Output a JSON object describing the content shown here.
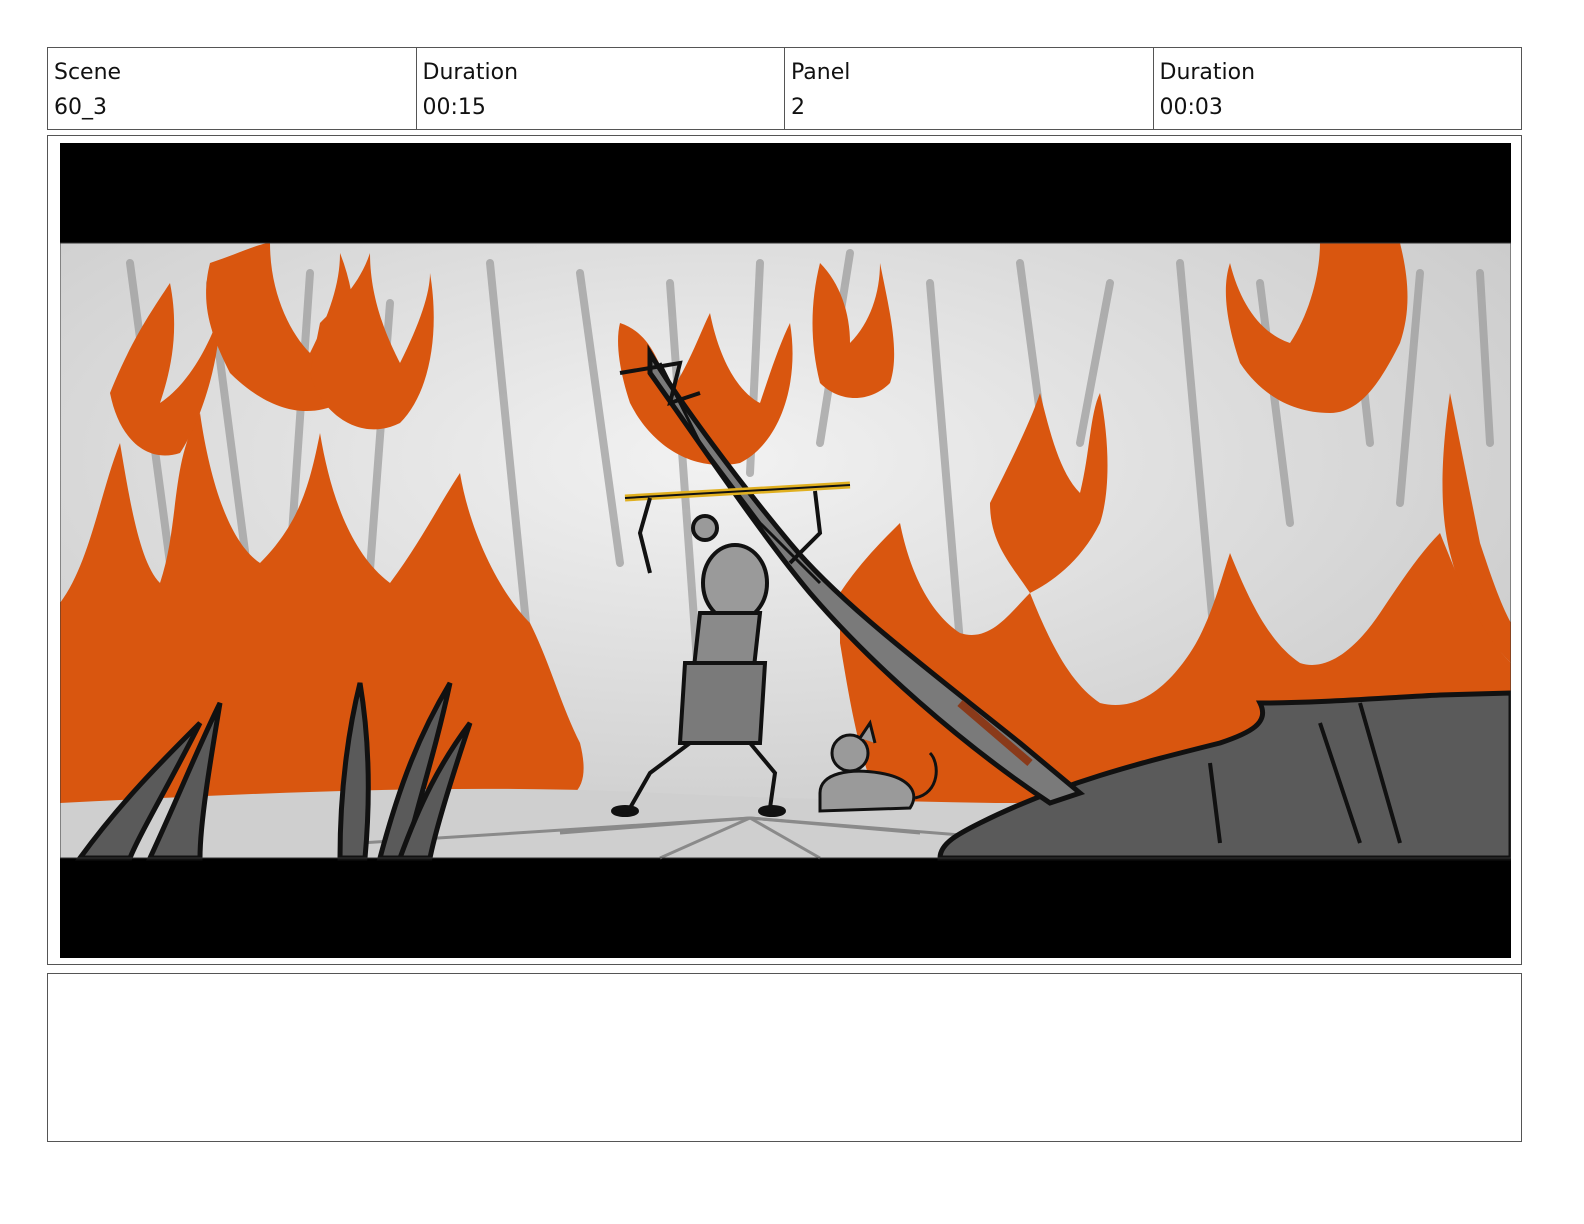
{
  "header": {
    "scene_label": "Scene",
    "scene_value": "60_3",
    "scene_duration_label": "Duration",
    "scene_duration_value": "00:15",
    "panel_label": "Panel",
    "panel_value": "2",
    "panel_duration_label": "Duration",
    "panel_duration_value": "00:03"
  },
  "panel_image": {
    "colors": {
      "letterbox": "#000000",
      "sky": "#d9d9d9",
      "flame": "#d9560f",
      "ground": "#c8c8c8",
      "rock": "#5a5a5a",
      "staff": "#e0b020",
      "ink": "#111111"
    }
  },
  "notes": {
    "text": ""
  }
}
